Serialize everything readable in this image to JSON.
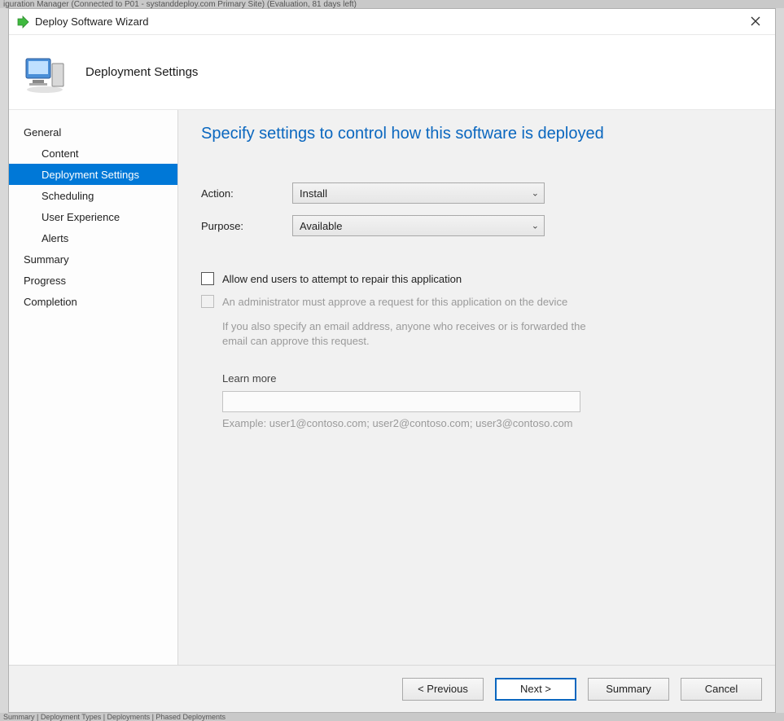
{
  "backdrop": {
    "top": "iguration Manager (Connected to P01 - systanddeploy.com Primary Site) (Evaluation, 81 days left)",
    "bottom": "Summary | Deployment Types | Deployments | Phased Deployments"
  },
  "titlebar": {
    "title": "Deploy Software Wizard"
  },
  "header": {
    "title": "Deployment Settings"
  },
  "sidebar": {
    "items": [
      {
        "label": "General",
        "child": false,
        "selected": false
      },
      {
        "label": "Content",
        "child": true,
        "selected": false
      },
      {
        "label": "Deployment Settings",
        "child": true,
        "selected": true
      },
      {
        "label": "Scheduling",
        "child": true,
        "selected": false
      },
      {
        "label": "User Experience",
        "child": true,
        "selected": false
      },
      {
        "label": "Alerts",
        "child": true,
        "selected": false
      },
      {
        "label": "Summary",
        "child": false,
        "selected": false
      },
      {
        "label": "Progress",
        "child": false,
        "selected": false
      },
      {
        "label": "Completion",
        "child": false,
        "selected": false
      }
    ]
  },
  "page": {
    "heading": "Specify settings to control how this software is deployed",
    "action_label": "Action:",
    "action_value": "Install",
    "purpose_label": "Purpose:",
    "purpose_value": "Available",
    "repair_checkbox": "Allow end users to attempt to repair this application",
    "approve_checkbox": "An administrator must approve a request for this application on the device",
    "approve_info": "If you also specify an email address, anyone who receives or is forwarded the email can approve this request.",
    "learn_more": "Learn more",
    "email_value": "",
    "example": "Example: user1@contoso.com; user2@contoso.com; user3@contoso.com"
  },
  "footer": {
    "previous": "< Previous",
    "next": "Next >",
    "summary": "Summary",
    "cancel": "Cancel"
  }
}
